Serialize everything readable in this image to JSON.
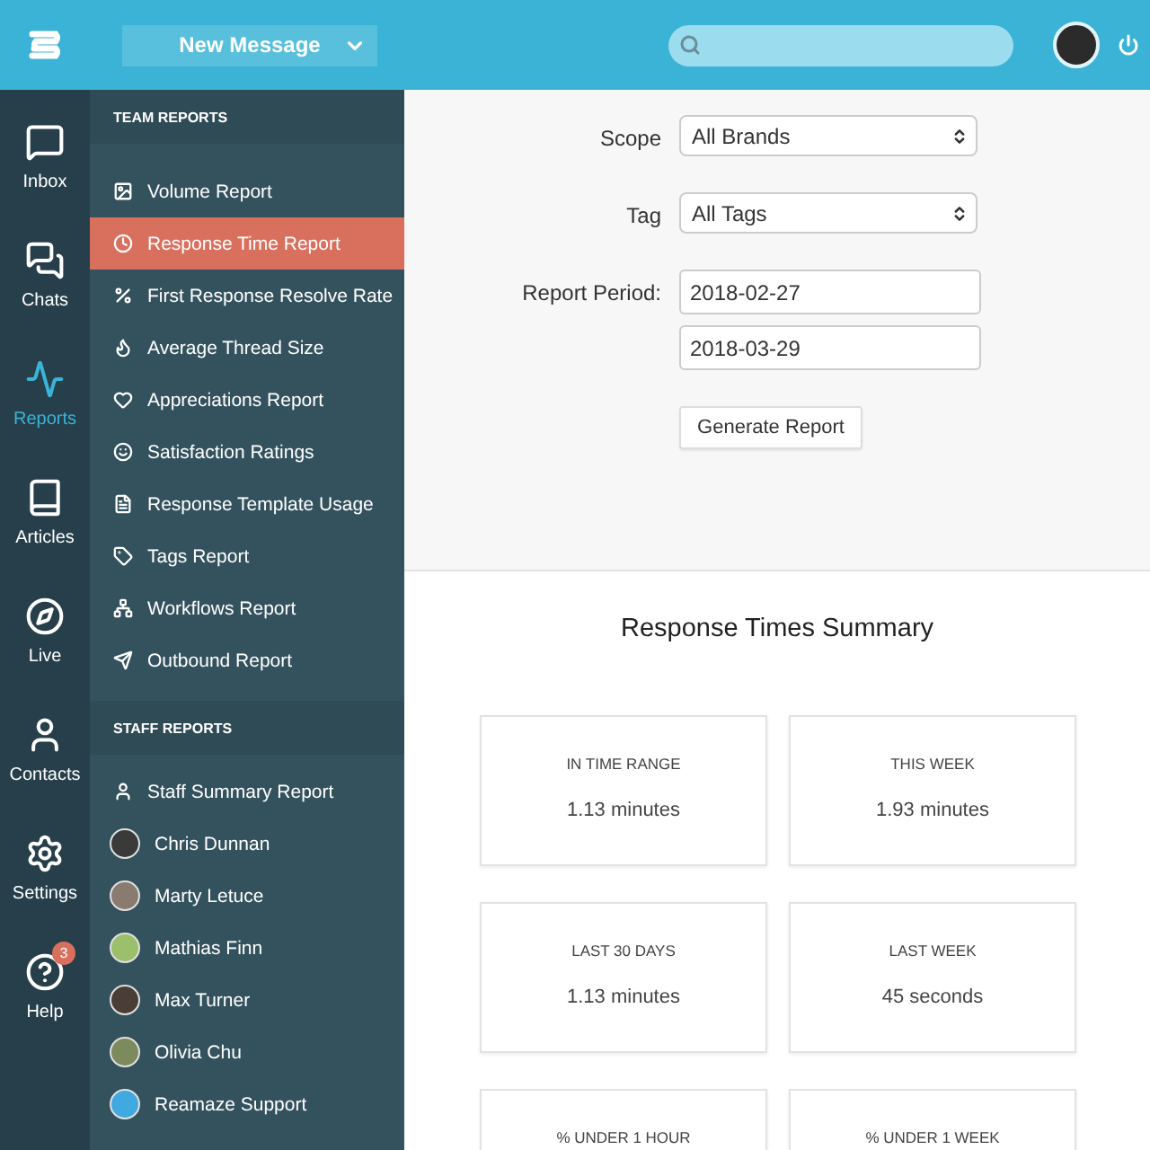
{
  "topbar": {
    "new_message": "New Message"
  },
  "rail": [
    {
      "label": "Inbox",
      "selected": false
    },
    {
      "label": "Chats",
      "selected": false
    },
    {
      "label": "Reports",
      "selected": true
    },
    {
      "label": "Articles",
      "selected": false
    },
    {
      "label": "Live",
      "selected": false
    },
    {
      "label": "Contacts",
      "selected": false
    },
    {
      "label": "Settings",
      "selected": false
    },
    {
      "label": "Help",
      "selected": false,
      "badge": "3"
    }
  ],
  "team_reports": {
    "title": "TEAM REPORTS",
    "items": [
      {
        "label": "Volume Report",
        "selected": false
      },
      {
        "label": "Response Time Report",
        "selected": true
      },
      {
        "label": "First Response Resolve Rate",
        "selected": false
      },
      {
        "label": "Average Thread Size",
        "selected": false
      },
      {
        "label": "Appreciations Report",
        "selected": false
      },
      {
        "label": "Satisfaction Ratings",
        "selected": false
      },
      {
        "label": "Response Template Usage",
        "selected": false
      },
      {
        "label": "Tags Report",
        "selected": false
      },
      {
        "label": "Workflows Report",
        "selected": false
      },
      {
        "label": "Outbound Report",
        "selected": false
      }
    ]
  },
  "staff_reports": {
    "title": "STAFF REPORTS",
    "items": [
      {
        "kind": "report",
        "label": "Staff Summary Report",
        "selected": false
      },
      {
        "kind": "person",
        "label": "Chris Dunnan",
        "selected": false,
        "color": "#3a3a3a"
      },
      {
        "kind": "person",
        "label": "Marty Letuce",
        "selected": false,
        "color": "#8a7b70"
      },
      {
        "kind": "person",
        "label": "Mathias Finn",
        "selected": false,
        "color": "#9bbf6a"
      },
      {
        "kind": "person",
        "label": "Max Turner",
        "selected": false,
        "color": "#4a3d36"
      },
      {
        "kind": "person",
        "label": "Olivia Chu",
        "selected": false,
        "color": "#7d8a5e"
      },
      {
        "kind": "person",
        "label": "Reamaze Support",
        "selected": false,
        "color": "#3fa9e0"
      }
    ]
  },
  "form": {
    "fields": [
      {
        "kind": "select",
        "label": "Scope",
        "value": "All Brands"
      },
      {
        "kind": "select",
        "label": "Tag",
        "value": "All Tags"
      },
      {
        "kind": "dates",
        "label": "Report Period:",
        "values": [
          "2018-02-27",
          "2018-03-29"
        ]
      }
    ],
    "button": "Generate Report"
  },
  "summary": {
    "title": "Response Times Summary",
    "cards": [
      {
        "label": "IN TIME RANGE",
        "value": "1.13 minutes"
      },
      {
        "label": "THIS WEEK",
        "value": "1.93 minutes"
      },
      {
        "label": "LAST 30 DAYS",
        "value": "1.13 minutes"
      },
      {
        "label": "LAST WEEK",
        "value": "45 seconds"
      },
      {
        "label": "% UNDER 1 HOUR"
      },
      {
        "label": "% UNDER 1 WEEK"
      }
    ]
  }
}
